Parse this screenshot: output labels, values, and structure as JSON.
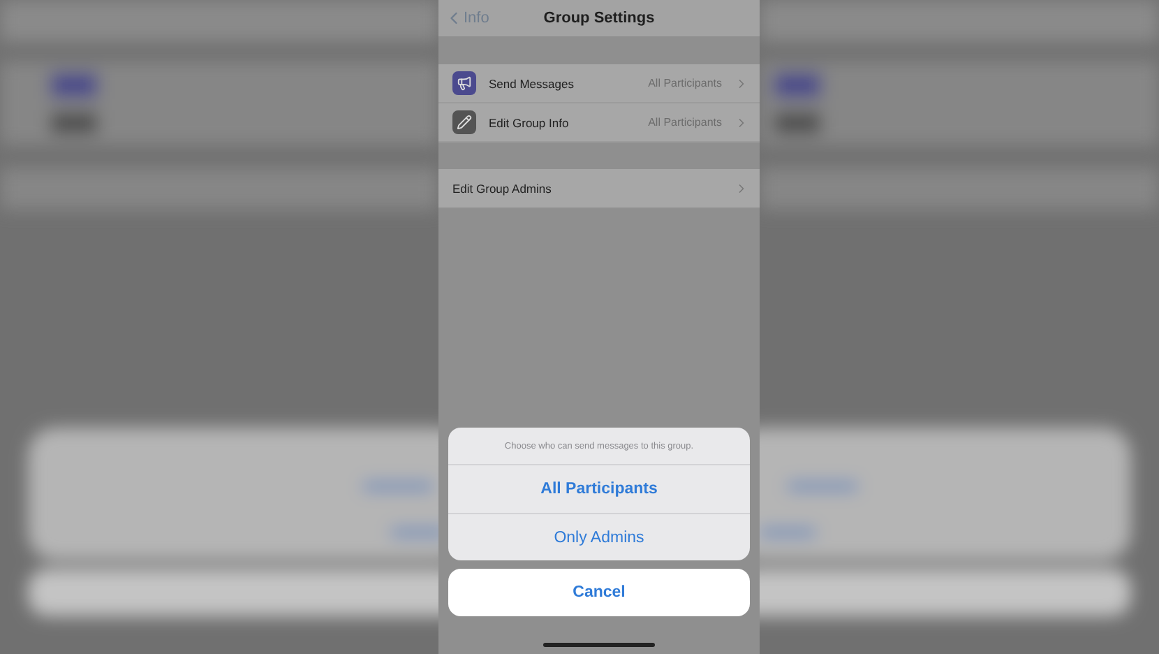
{
  "nav": {
    "back": "Info",
    "title": "Group Settings"
  },
  "permissions": [
    {
      "label": "Send Messages",
      "value": "All Participants"
    },
    {
      "label": "Edit Group Info",
      "value": "All Participants"
    }
  ],
  "admins_row": {
    "label": "Edit Group Admins"
  },
  "action_sheet": {
    "message": "Choose who can send messages to this group.",
    "options": [
      {
        "label": "All Participants",
        "preferred": true
      },
      {
        "label": "Only Admins",
        "preferred": false
      }
    ],
    "cancel": "Cancel"
  }
}
